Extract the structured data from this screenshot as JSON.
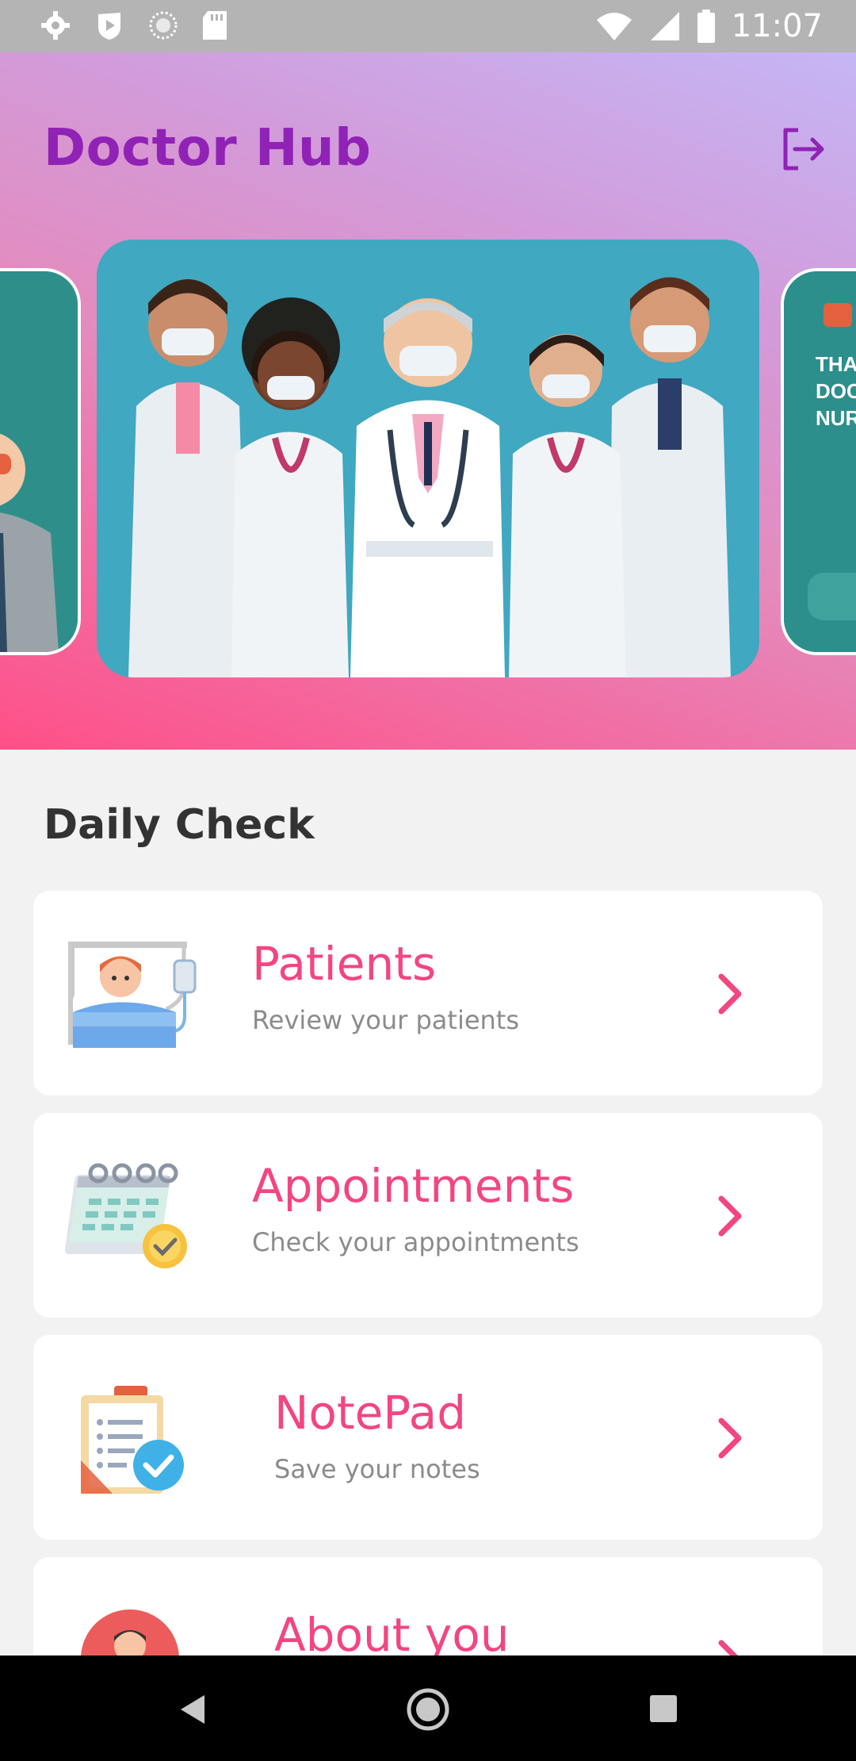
{
  "status_bar": {
    "time": "11:07",
    "left_icons": [
      "settings-icon",
      "shield-play-icon",
      "sync-icon",
      "sd-card-icon"
    ],
    "right_icons": [
      "wifi-icon",
      "signal-icon",
      "battery-icon"
    ]
  },
  "header": {
    "title": "Doctor Hub",
    "logout_icon": "logout-icon",
    "gradient_colors": [
      "#ff4f88",
      "#e48bbd",
      "#d39ad9",
      "#c5b6f5"
    ],
    "title_color": "#9022b6"
  },
  "carousel": {
    "right_card_text": [
      "THAN",
      "DOCT",
      "NURS"
    ]
  },
  "daily_check": {
    "title": "Daily Check",
    "items": [
      {
        "title": "Patients",
        "subtitle": "Review your patients",
        "icon": "patient-bed-icon"
      },
      {
        "title": "Appointments",
        "subtitle": "Check your appointments",
        "icon": "calendar-check-icon"
      },
      {
        "title": "NotePad",
        "subtitle": "Save your notes",
        "icon": "clipboard-check-icon"
      },
      {
        "title": "About you",
        "subtitle": "",
        "icon": "avatar-icon"
      }
    ],
    "accent_color": "#f2467f"
  },
  "nav_bar": {
    "buttons": [
      "back-icon",
      "home-icon",
      "recents-icon"
    ]
  }
}
